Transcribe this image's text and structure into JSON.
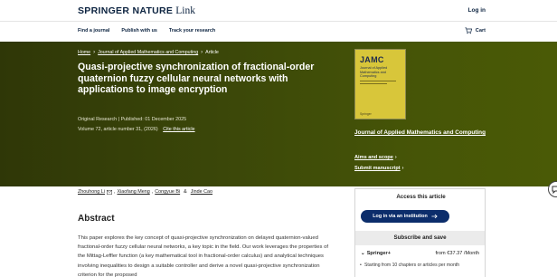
{
  "header": {
    "brand": "SPRINGER NATURE",
    "brand_suffix": "Link",
    "login": "Log in",
    "nav": [
      "Find a journal",
      "Publish with us",
      "Track your research"
    ],
    "cart": "Cart"
  },
  "breadcrumb": [
    "Home",
    "Journal of Applied Mathematics and Computing",
    "Article"
  ],
  "article": {
    "title": "Quasi-projective synchronization of fractional-order quaternion fuzzy cellular neural networks with applications to image encryption",
    "type": "Original Research",
    "published": "Published: 01 December 2025",
    "volume": "Volume 72, article number 31, (2026)",
    "cite": "Cite this article"
  },
  "journal": {
    "cover_abbrev": "JAMC",
    "cover_title": "Journal of Applied Mathematics and Computing",
    "cover_publisher": "Springer",
    "name": "Journal of Applied Mathematics and Computing",
    "aims": "Aims and scope",
    "submit": "Submit manuscript"
  },
  "authors": [
    "Zhouhong Li",
    "Xiaofang Meng",
    "Congyue Bi",
    "Jinde Cao"
  ],
  "abstract": {
    "heading": "Abstract",
    "text": "This paper explores the key concept of quasi-projective synchronization on delayed quaternion-valued fractional-order fuzzy cellular neural networks, a key topic in the field. Our work leverages the properties of the Mittag-Leffler function (a key mathematical tool in fractional-order calculus) and analytical techniques involving inequalities to design a suitable controller and derive a novel quasi-projective synchronization criterion for the proposed"
  },
  "access": {
    "heading": "Access this article",
    "login_button": "Log in via an institution",
    "subscribe_heading": "Subscribe and save",
    "plan": "Springer+",
    "price": "from €37.37 /Month",
    "bullet": "Starting from 10 chapters or articles per month"
  }
}
